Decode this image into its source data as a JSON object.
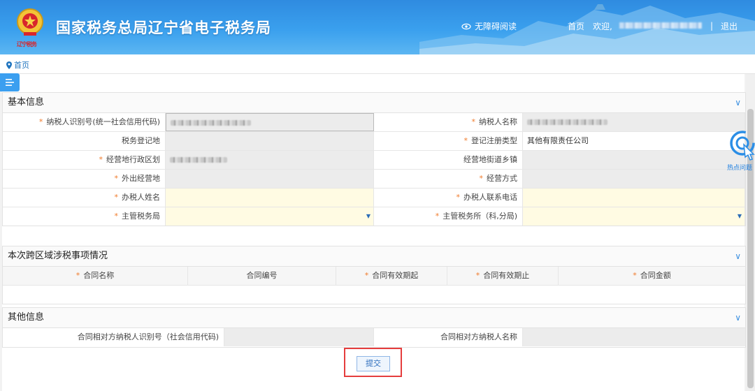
{
  "header": {
    "title": "国家税务总局辽宁省电子税务局",
    "emblem_caption": "辽宁税务",
    "accessibility_label": "无障碍阅读",
    "home_label": "首页",
    "welcome_label": "欢迎,",
    "separator": "|",
    "logout_label": "退出"
  },
  "breadcrumb": {
    "home": "首页"
  },
  "hot_issue_label": "热点问题",
  "basic_info": {
    "title": "基本信息",
    "fields": {
      "taxpayer_id_label": "纳税人识别号(统一社会信用代码)",
      "taxpayer_name_label": "纳税人名称",
      "tax_registration_place_label": "税务登记地",
      "registration_type_label": "登记注册类型",
      "registration_type_value": "其他有限责任公司",
      "admin_region_label": "经营地行政区划",
      "street_town_label": "经营地街道乡镇",
      "outside_place_label": "外出经营地",
      "business_mode_label": "经营方式",
      "handler_name_label": "办税人姓名",
      "handler_phone_label": "办税人联系电话",
      "tax_bureau_label": "主管税务局",
      "tax_office_label": "主管税务所（科,分局)"
    }
  },
  "cross_region": {
    "title": "本次跨区域涉税事项情况",
    "columns": [
      "合同名称",
      "合同编号",
      "合同有效期起",
      "合同有效期止",
      "合同金额"
    ],
    "required": [
      true,
      false,
      true,
      true,
      true
    ]
  },
  "other_info": {
    "title": "其他信息",
    "counterparty_id_label": "合同相对方纳税人识别号（社会信用代码)",
    "counterparty_name_label": "合同相对方纳税人名称"
  },
  "submit_label": "提交",
  "colors": {
    "header_blue": "#3aa0ee",
    "required_star": "#f07a2a",
    "highlight_red": "#e53d3d",
    "input_yellow": "#fffbe3"
  }
}
